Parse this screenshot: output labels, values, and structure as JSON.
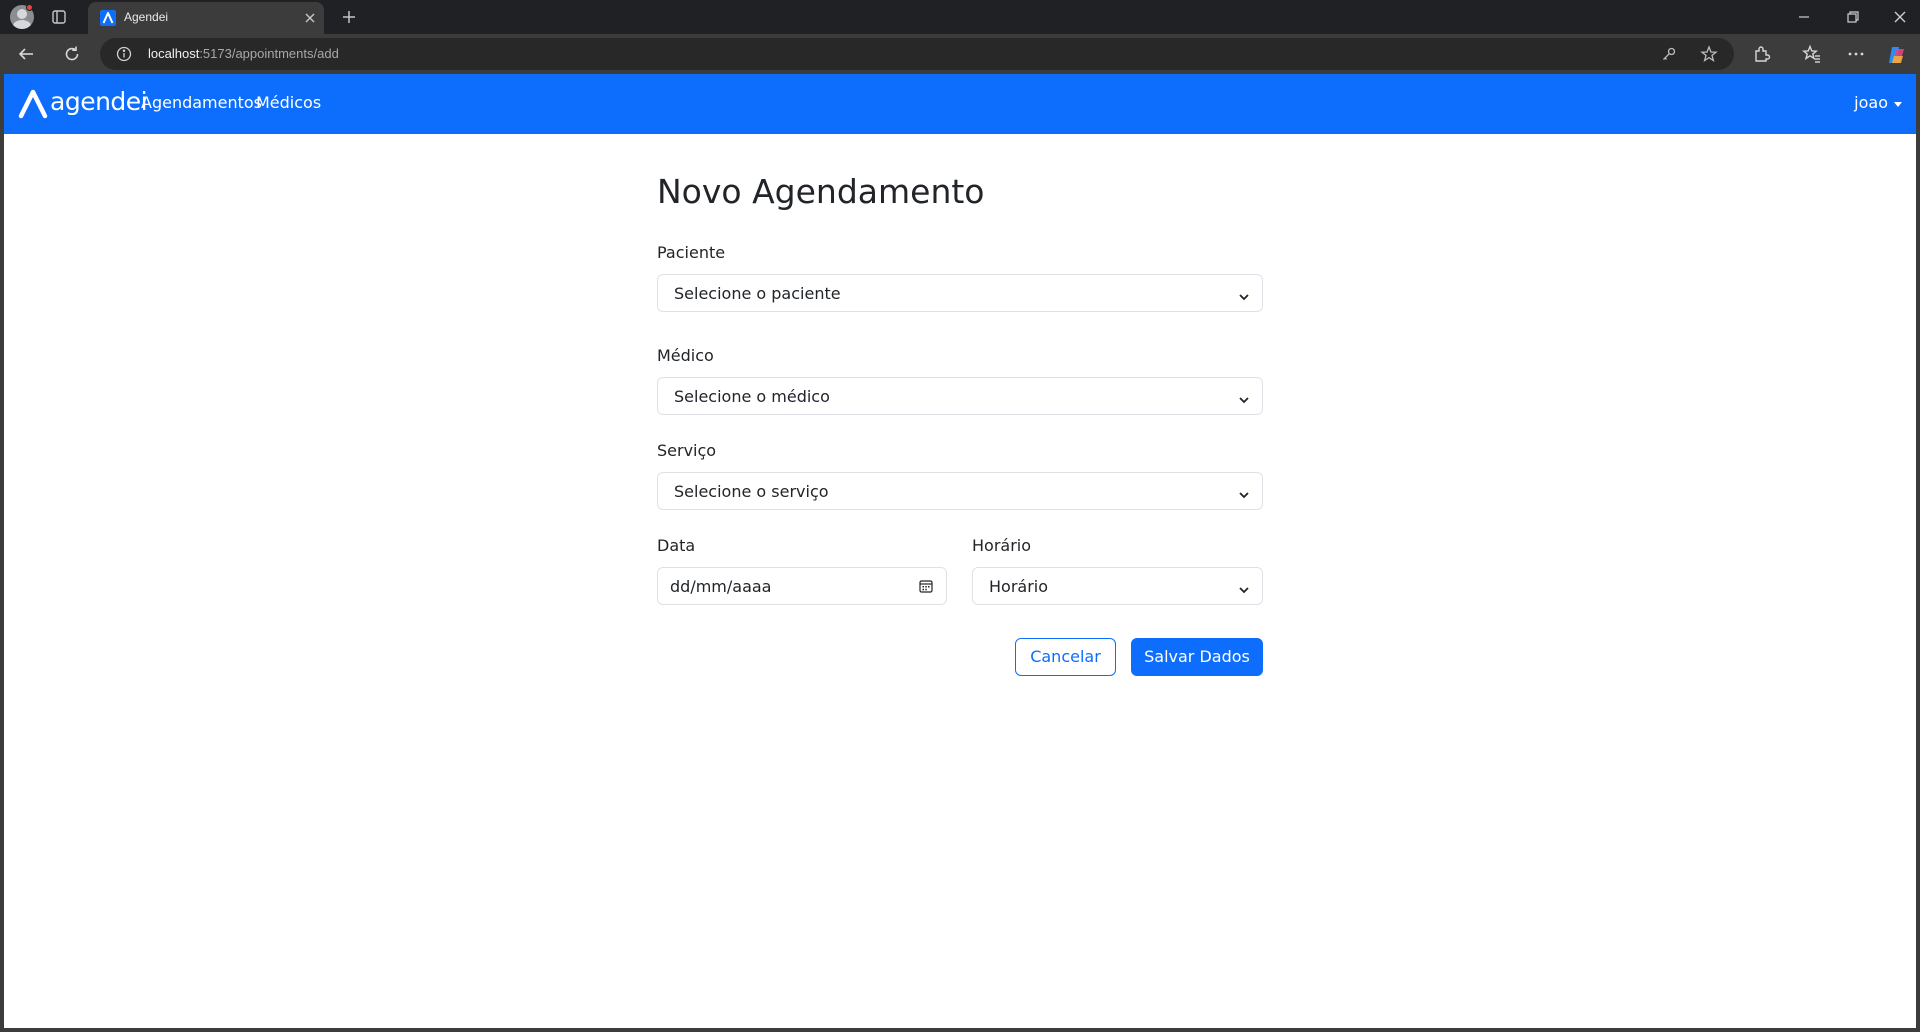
{
  "browser": {
    "tab_title": "Agendei",
    "url_host": "localhost",
    "url_rest": ":5173/appointments/add"
  },
  "navbar": {
    "brand": "agendei",
    "links": [
      "Agendamentos",
      "Médicos"
    ],
    "user": "joao",
    "color": "#0d6efd"
  },
  "form": {
    "title": "Novo Agendamento",
    "patient": {
      "label": "Paciente",
      "selected": "Selecione o paciente"
    },
    "doctor": {
      "label": "Médico",
      "selected": "Selecione o médico"
    },
    "service": {
      "label": "Serviço",
      "selected": "Selecione o serviço"
    },
    "date": {
      "label": "Data",
      "value": "dd/mm/aaaa"
    },
    "time": {
      "label": "Horário",
      "selected": "Horário"
    },
    "cancel_label": "Cancelar",
    "save_label": "Salvar Dados"
  }
}
